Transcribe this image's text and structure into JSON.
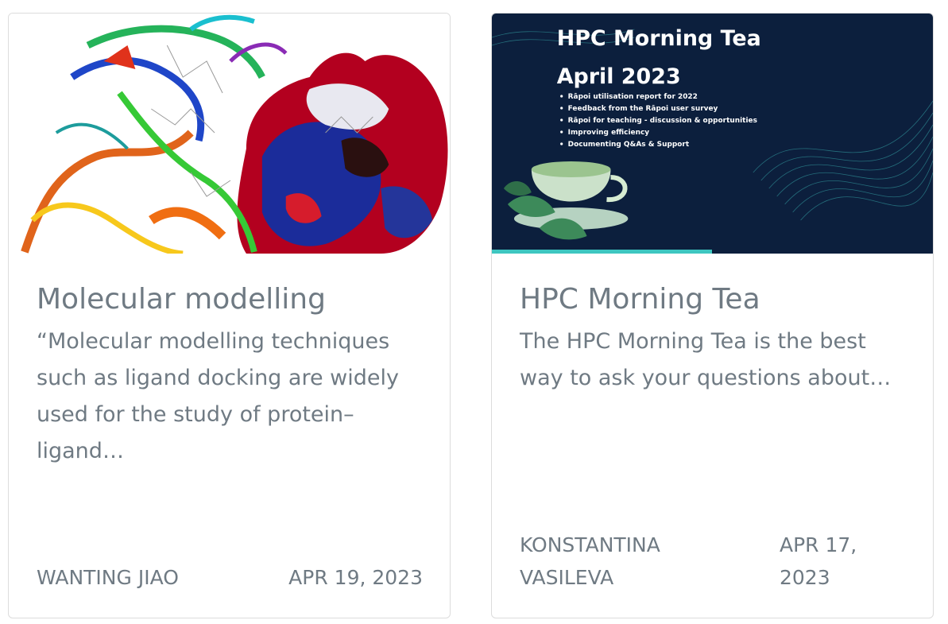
{
  "cards": [
    {
      "title": "Molecular modelling",
      "excerpt": "“Molecular modelling techniques such as ligand docking are widely used for the study of protein–ligand…",
      "author": "WANTING JIAO",
      "date": "APR 19, 2023",
      "image": "molecular-protein-render"
    },
    {
      "title": "HPC Morning Tea",
      "excerpt": "The HPC Morning Tea is the best way to ask your questions about…",
      "author_line1": "KONSTANTINA",
      "author_line2": "VASILEVA",
      "date_line1": "APR 17,",
      "date_line2": "2023",
      "image": "hpc-morning-tea-banner",
      "banner": {
        "title_line1": "HPC Morning Tea",
        "title_line2": "April 2023",
        "bullets": [
          "Rāpoi utilisation report for 2022",
          "Feedback from the  Rāpoi user survey",
          "Rāpoi for teaching - discussion & opportunities",
          "Improving efficiency",
          "Documenting Q&As & Support"
        ]
      }
    }
  ],
  "colors": {
    "banner_bg": "#0c1f3d",
    "banner_accent": "#3ec6c0",
    "text": "#6f7a83"
  }
}
